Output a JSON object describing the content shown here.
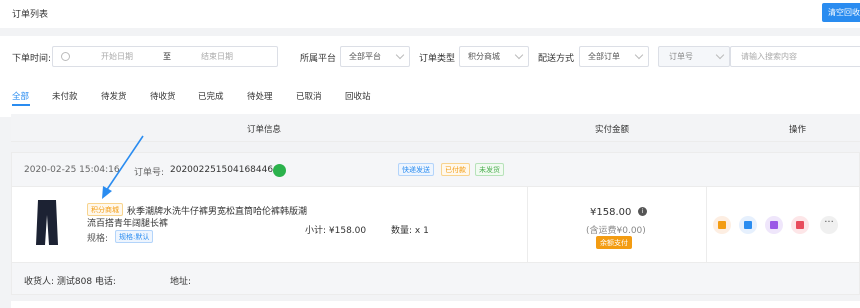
{
  "header": {
    "title": "订单列表",
    "clear_button": "清空回收站"
  },
  "filters": {
    "order_time_label": "下单时间:",
    "start_date_placeholder": "开始日期",
    "to_label": "至",
    "end_date_placeholder": "结束日期",
    "platform_label": "所属平台",
    "platform_value": "全部平台",
    "order_type_label": "订单类型",
    "order_type_value": "积分商城",
    "delivery_label": "配送方式",
    "delivery_value": "全部订单",
    "search_field_value": "订单号",
    "search_placeholder": "请输入搜索内容"
  },
  "tabs": [
    {
      "label": "全部",
      "active": true
    },
    {
      "label": "未付款"
    },
    {
      "label": "待发货"
    },
    {
      "label": "待收货"
    },
    {
      "label": "已完成"
    },
    {
      "label": "待处理"
    },
    {
      "label": "已取消"
    },
    {
      "label": "回收站"
    }
  ],
  "table": {
    "col_info": "订单信息",
    "col_amount": "实付金额",
    "col_actions": "操作"
  },
  "order": {
    "time": "2020-02-25 15:04:16",
    "order_no_label": "订单号:",
    "order_no": "20200225150416844667",
    "tags": [
      "快递发送",
      "已付款",
      "未发货"
    ],
    "product_tag": "积分商城",
    "product_name": "秋季潮牌水洗牛仔裤男宽松直筒哈伦裤韩版潮流百搭青年阔腿长裤",
    "spec_label": "规格:",
    "spec_value": "规格:默认",
    "subtotal": "小计: ¥158.00",
    "quantity": "数量: x 1",
    "amount": "¥158.00",
    "shipping": "(含运费¥0.00)",
    "pay_method": "余额支付",
    "receiver": "收货人: 测试808 电话:",
    "address": "地址:"
  },
  "colors": {
    "accent": "#2a8cf0",
    "arrow": "#2a8cf0"
  }
}
